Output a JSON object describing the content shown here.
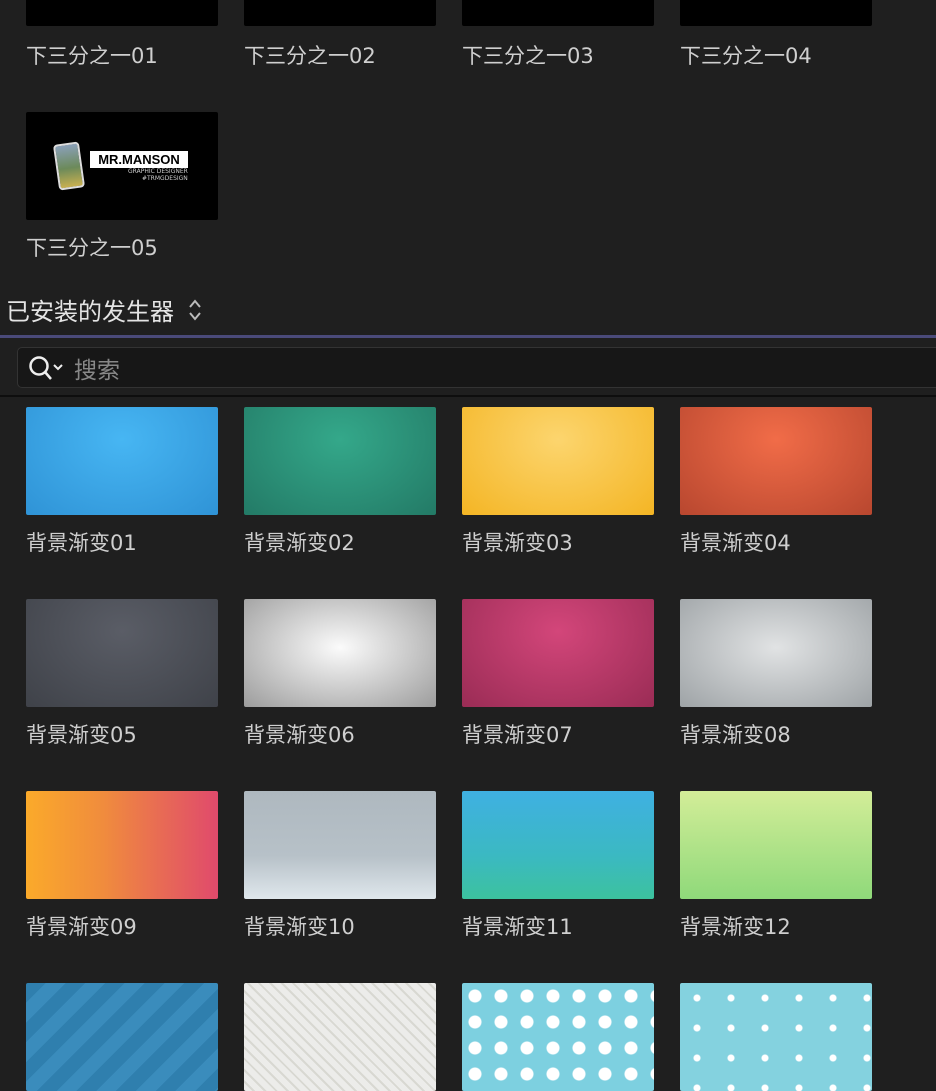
{
  "top_items": [
    {
      "label": "下三分之一01"
    },
    {
      "label": "下三分之一02"
    },
    {
      "label": "下三分之一03"
    },
    {
      "label": "下三分之一04"
    },
    {
      "label": "下三分之一05"
    }
  ],
  "thumb05": {
    "name": "MR.MANSON",
    "line1": "GRAPHIC DESIGNER",
    "line2": "#TRMGDESIGN"
  },
  "section": {
    "title": "已安装的发生器"
  },
  "search": {
    "placeholder": "搜索"
  },
  "generators": [
    {
      "label": "背景渐变01",
      "bg": "radial-gradient(ellipse at 50% 30%,#47b6f3,#2f93d6)"
    },
    {
      "label": "背景渐变02",
      "bg": "radial-gradient(ellipse at 50% 30%,#34a88a,#237a66)"
    },
    {
      "label": "背景渐变03",
      "bg": "radial-gradient(ellipse at 50% 30%,#fcd56e,#f4b524)"
    },
    {
      "label": "背景渐变04",
      "bg": "radial-gradient(ellipse at 50% 30%,#f16c48,#b8472f)"
    },
    {
      "label": "背景渐变05",
      "bg": "radial-gradient(ellipse at 50% 30%,#5a5d66,#3f4249)"
    },
    {
      "label": "背景渐变06",
      "bg": "radial-gradient(ellipse at 50% 45%,#fbfbfb,#9c9c9c)"
    },
    {
      "label": "背景渐变07",
      "bg": "radial-gradient(ellipse at 50% 30%,#d3467a,#9a2c55)"
    },
    {
      "label": "背景渐变08",
      "bg": "radial-gradient(ellipse at 50% 45%,#e1e3e4,#9ea3a6)"
    },
    {
      "label": "背景渐变09",
      "bg": "linear-gradient(90deg,#fbaa2a,#f08c3d 40%,#e04a6c)"
    },
    {
      "label": "背景渐变10",
      "bg": "linear-gradient(#aeb8bf,#b7c1c8 60%,#dfe7ec)"
    },
    {
      "label": "背景渐变11",
      "bg": "linear-gradient(#3fb0e2,#3bb9c2 60%,#3cc29e)"
    },
    {
      "label": "背景渐变12",
      "bg": "linear-gradient(#d3ed98,#8fd97a)"
    },
    {
      "label": "",
      "bg": "repeating-linear-gradient(135deg,#2f7fae 0 14px,#3a8cbc 14px 28px)"
    },
    {
      "label": "",
      "bg": "repeating-linear-gradient(45deg,#ececea 0 6px,#d8d8d2 6px 8px)"
    },
    {
      "label": "",
      "bg": "radial-gradient(circle,#fff 6px,#7dd0e0 7px) 0 0/26px 26px"
    },
    {
      "label": "",
      "bg": "radial-gradient(circle,#fff 3px,#84d2df 4px) 0 0/34px 30px"
    }
  ]
}
